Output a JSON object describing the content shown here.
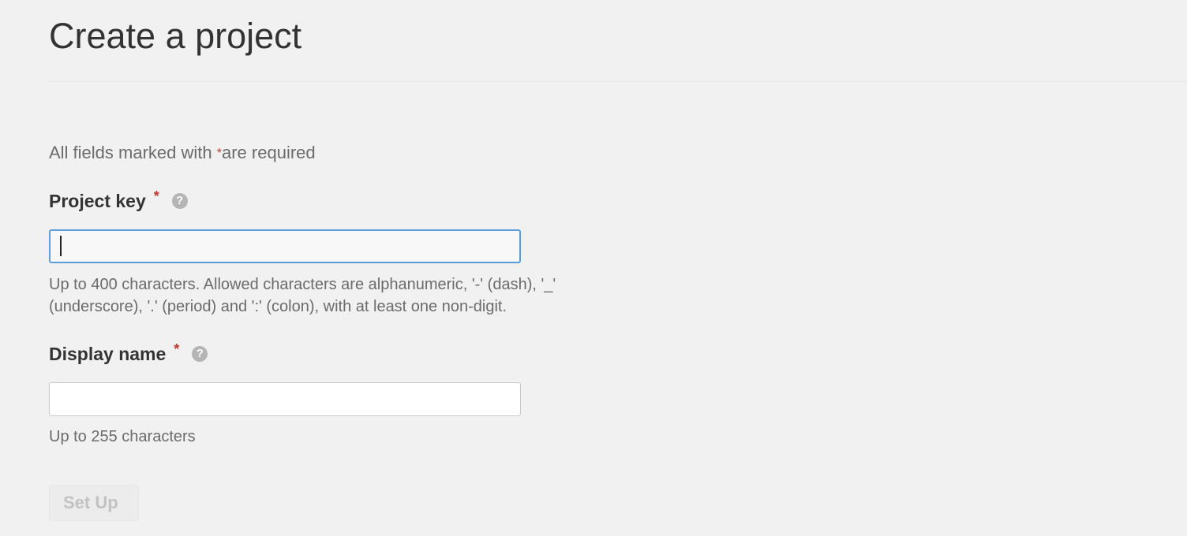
{
  "page": {
    "title": "Create a project"
  },
  "form": {
    "required_note_prefix": "All fields marked with",
    "required_star": "*",
    "required_note_suffix": "are required",
    "project_key": {
      "label": "Project key",
      "star": "*",
      "help_icon": "?",
      "value": "",
      "hint_line1": "Up to 400 characters. Allowed characters are alphanumeric, '-' (dash), '_'",
      "hint_line2": "(underscore), '.' (period) and ':' (colon), with at least one non-digit."
    },
    "display_name": {
      "label": "Display name",
      "star": "*",
      "help_icon": "?",
      "value": "",
      "hint": "Up to 255 characters"
    },
    "setup_button": "Set Up"
  },
  "colors": {
    "background": "#f1f1f1",
    "required_star": "#c0392b",
    "focus_border": "#5b9dd9"
  },
  "icons": {
    "help": "question-circle-icon"
  }
}
